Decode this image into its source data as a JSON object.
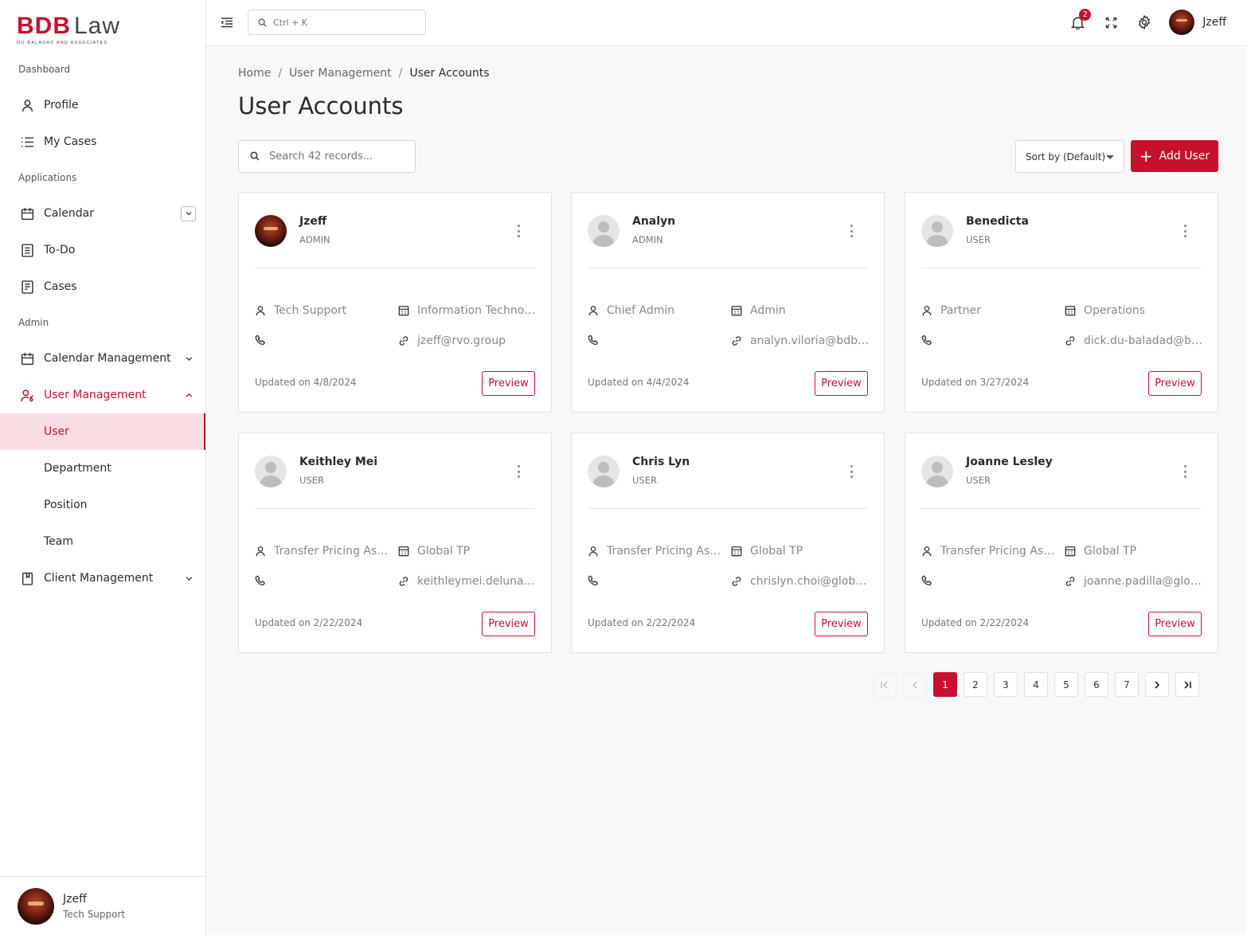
{
  "brand": {
    "main": "BDB",
    "law": "Law",
    "subtitle": "DU-BALADAD AND ASSOCIATES"
  },
  "sidebar": {
    "sections": [
      "Dashboard",
      "Applications",
      "Admin"
    ],
    "items": {
      "profile": "Profile",
      "my_cases": "My Cases",
      "calendar": "Calendar",
      "todo": "To-Do",
      "cases": "Cases",
      "calendar_mgmt": "Calendar Management",
      "user_mgmt": "User Management",
      "client_mgmt": "Client Management"
    },
    "user_mgmt_sub": [
      "User",
      "Department",
      "Position",
      "Team"
    ],
    "footer": {
      "name": "Jzeff",
      "role": "Tech Support"
    }
  },
  "topbar": {
    "search_placeholder": "Ctrl + K",
    "notification_count": "2",
    "user_name": "Jzeff"
  },
  "breadcrumb": [
    "Home",
    "User Management",
    "User Accounts"
  ],
  "page_title": "User Accounts",
  "toolbar": {
    "search_placeholder": "Search 42 records...",
    "sort_label": "Sort by (Default)",
    "add_label": "Add User"
  },
  "cards": [
    {
      "name": "Jzeff",
      "role": "ADMIN",
      "position": "Tech Support",
      "department": "Information Technolo...",
      "phone": "",
      "email": "jzeff@rvo.group",
      "updated": "Updated on 4/8/2024",
      "photo": true
    },
    {
      "name": "Analyn",
      "role": "ADMIN",
      "position": "Chief Admin",
      "department": "Admin",
      "phone": "",
      "email": "analyn.viloria@bdbla...",
      "updated": "Updated on 4/4/2024",
      "photo": false
    },
    {
      "name": "Benedicta",
      "role": "USER",
      "position": "Partner",
      "department": "Operations",
      "phone": "",
      "email": "dick.du-baladad@bd...",
      "updated": "Updated on 3/27/2024",
      "photo": false
    },
    {
      "name": "Keithley Mei",
      "role": "USER",
      "position": "Transfer Pricing Ass...",
      "department": "Global TP",
      "phone": "",
      "email": "keithleymei.deluna@...",
      "updated": "Updated on 2/22/2024",
      "photo": false
    },
    {
      "name": "Chris Lyn",
      "role": "USER",
      "position": "Transfer Pricing Ass...",
      "department": "Global TP",
      "phone": "",
      "email": "chrislyn.choi@global...",
      "updated": "Updated on 2/22/2024",
      "photo": false
    },
    {
      "name": "Joanne Lesley",
      "role": "USER",
      "position": "Transfer Pricing Ass...",
      "department": "Global TP",
      "phone": "",
      "email": "joanne.padilla@glob...",
      "updated": "Updated on 2/22/2024",
      "photo": false
    }
  ],
  "preview_label": "Preview",
  "pagination": {
    "pages": [
      "1",
      "2",
      "3",
      "4",
      "5",
      "6",
      "7"
    ],
    "current": "1"
  },
  "colors": {
    "accent": "#c8102e",
    "accent_light": "#f8dde2"
  }
}
